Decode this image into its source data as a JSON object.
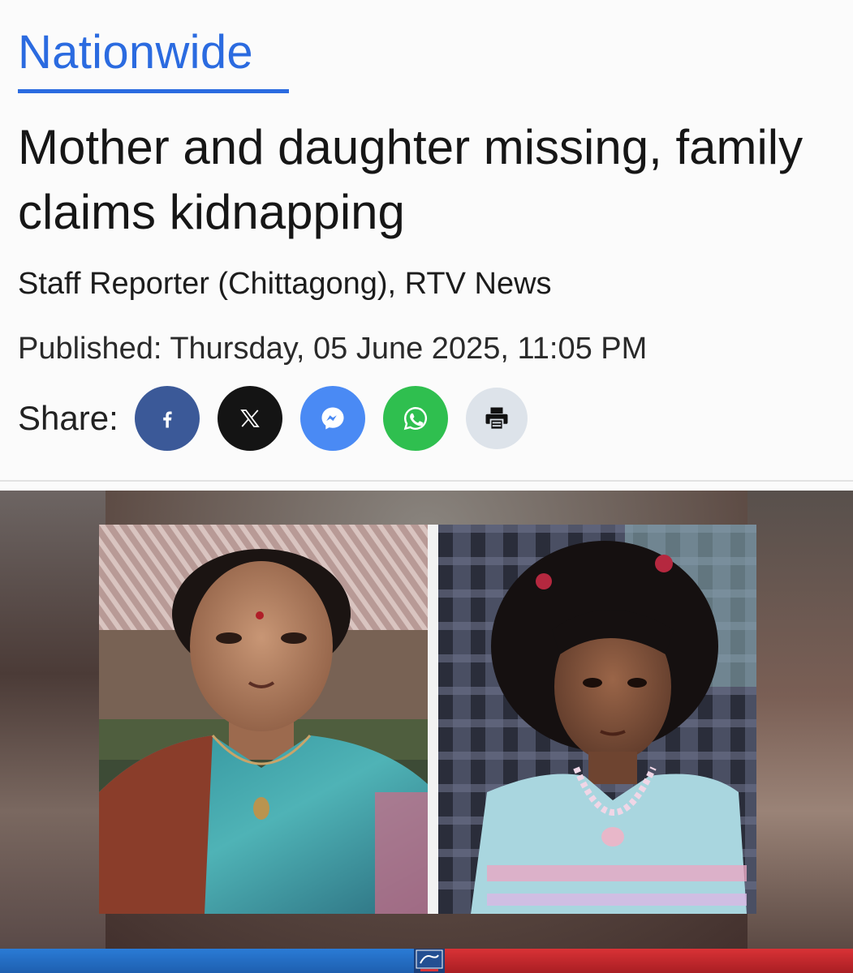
{
  "article": {
    "category": "Nationwide",
    "headline": "Mother and daughter missing, family claims kidnapping",
    "byline": "Staff Reporter (Chittagong), RTV News",
    "published": "Published: Thursday, 05 June 2025, 11:05 PM"
  },
  "share": {
    "label": "Share:",
    "buttons": [
      {
        "name": "facebook",
        "icon": "facebook-icon",
        "color": "#3b5998"
      },
      {
        "name": "x",
        "icon": "x-icon",
        "color": "#141414"
      },
      {
        "name": "messenger",
        "icon": "messenger-icon",
        "color": "#4a8af4"
      },
      {
        "name": "whatsapp",
        "icon": "whatsapp-icon",
        "color": "#2fbf4f"
      },
      {
        "name": "print",
        "icon": "printer-icon",
        "color": "#dde3ea"
      }
    ]
  },
  "colors": {
    "accent": "#2b6be0",
    "headline": "#161616",
    "banner_blue": "#2a7bd6",
    "banner_red": "#d93236"
  }
}
